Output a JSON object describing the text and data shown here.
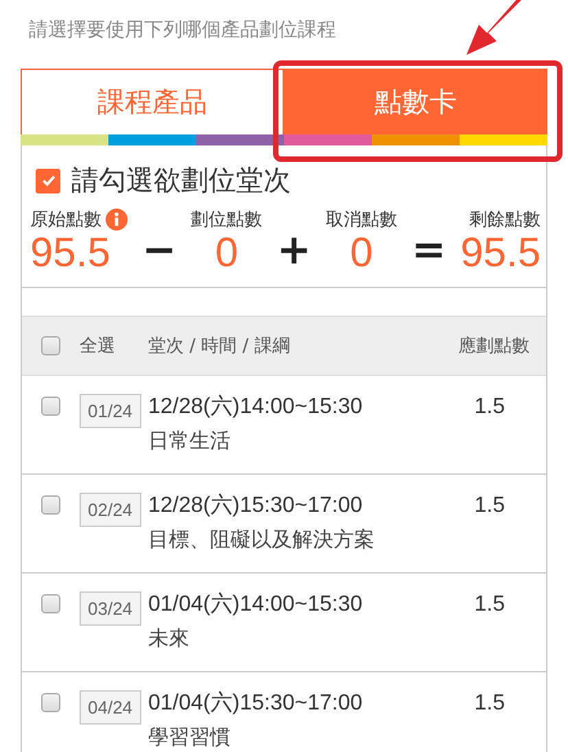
{
  "instruction": "請選擇要使用下列哪個產品劃位課程",
  "tabs": [
    {
      "label": "課程產品",
      "selected": false
    },
    {
      "label": "點數卡",
      "selected": true
    }
  ],
  "select_prompt": {
    "label": "請勾選欲劃位堂次",
    "checked": true
  },
  "summary": [
    {
      "kind": "figure",
      "label": "原始點數",
      "value": "95.5",
      "info": true
    },
    {
      "kind": "operator",
      "symbol": "−"
    },
    {
      "kind": "figure",
      "label": "劃位點數",
      "value": "0",
      "info": false
    },
    {
      "kind": "operator",
      "symbol": "+"
    },
    {
      "kind": "figure",
      "label": "取消點數",
      "value": "0",
      "info": false
    },
    {
      "kind": "operator",
      "symbol": "="
    },
    {
      "kind": "figure",
      "label": "剩餘點數",
      "value": "95.5",
      "info": false
    }
  ],
  "table": {
    "select_all": {
      "label": "全選",
      "checked": false
    },
    "columns": [
      "堂次 / 時間 / 課綱",
      "應劃點數"
    ],
    "rows": [
      {
        "checked": false,
        "session": "01/24",
        "time": "12/28(六)14:00~15:30",
        "topic": "日常生活",
        "points": "1.5"
      },
      {
        "checked": false,
        "session": "02/24",
        "time": "12/28(六)15:30~17:00",
        "topic": "目標、阻礙以及解決方案",
        "points": "1.5"
      },
      {
        "checked": false,
        "session": "03/24",
        "time": "01/04(六)14:00~15:30",
        "topic": "未來",
        "points": "1.5"
      },
      {
        "checked": false,
        "session": "04/24",
        "time": "01/04(六)15:30~17:00",
        "topic": "學習習慣",
        "points": "1.5"
      }
    ]
  }
}
